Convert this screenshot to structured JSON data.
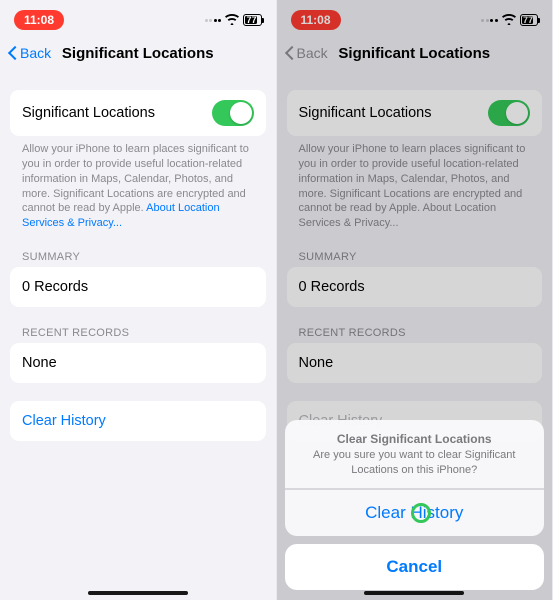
{
  "status": {
    "time": "11:08",
    "battery": "77"
  },
  "nav": {
    "back": "Back",
    "title": "Significant Locations"
  },
  "toggle_row": {
    "label": "Significant Locations"
  },
  "footer": {
    "text": "Allow your iPhone to learn places significant to you in order to provide useful location-related information in Maps, Calendar, Photos, and more. Significant Locations are encrypted and cannot be read by Apple.",
    "link": "About Location Services & Privacy..."
  },
  "summary": {
    "header": "SUMMARY",
    "value": "0 Records"
  },
  "recent": {
    "header": "RECENT RECORDS",
    "value": "None"
  },
  "clear": {
    "label": "Clear History"
  },
  "sheet": {
    "title": "Clear Significant Locations",
    "message": "Are you sure you want to clear Significant Locations on this iPhone?",
    "confirm": "Clear History",
    "cancel": "Cancel"
  }
}
